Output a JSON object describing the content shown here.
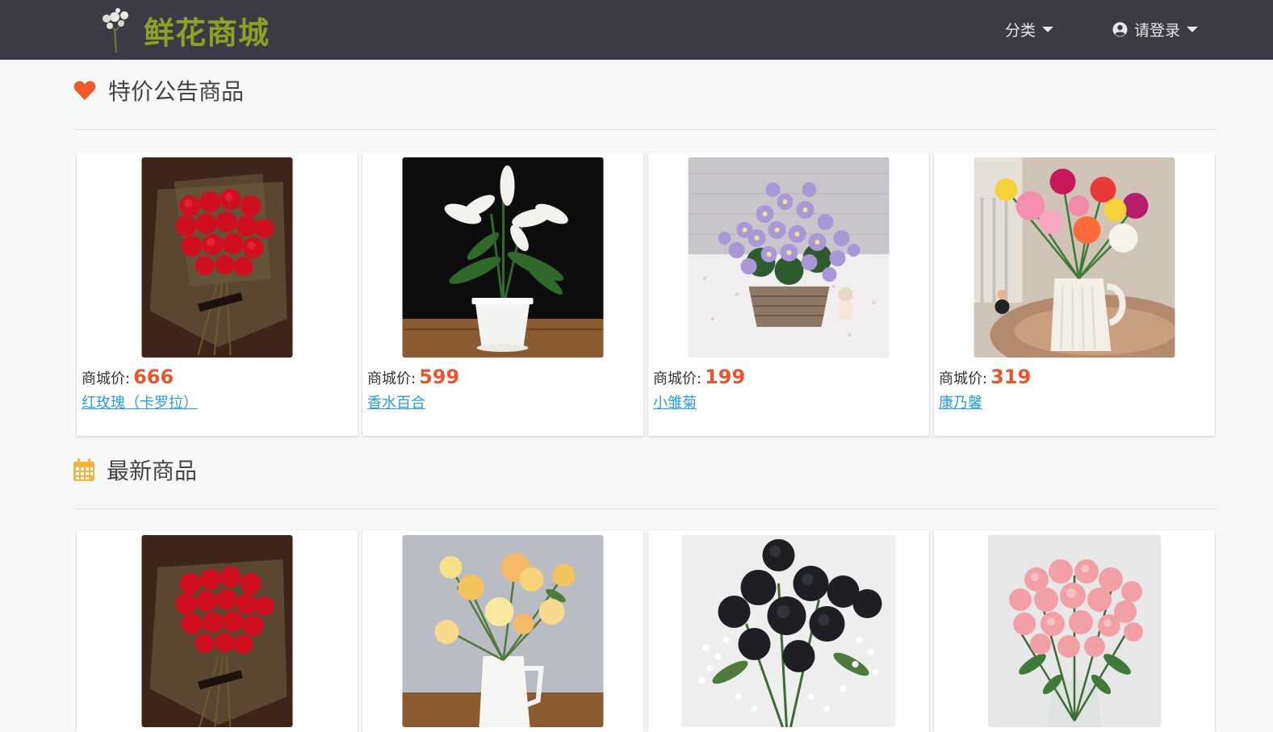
{
  "header": {
    "brand": "鲜花商城",
    "category_label": "分类",
    "login_label": "请登录"
  },
  "special_section": {
    "title": "特价公告商品",
    "price_label": "商城价:",
    "products": [
      {
        "name": "红玫瑰（卡罗拉）",
        "price": "666",
        "image": "red-rose-bouquet"
      },
      {
        "name": "香水百合",
        "price": "599",
        "image": "white-lily-pot"
      },
      {
        "name": "小雏菊",
        "price": "199",
        "image": "daisy-basket"
      },
      {
        "name": "康乃馨",
        "price": "319",
        "image": "carnation-vase"
      }
    ]
  },
  "new_section": {
    "title": "最新商品",
    "products": [
      {
        "image": "red-rose-bouquet"
      },
      {
        "image": "yellow-eustoma-vase"
      },
      {
        "image": "black-rose-bouquet"
      },
      {
        "image": "pink-rose-vase"
      }
    ]
  },
  "colors": {
    "navbar": "#3b3b45",
    "brand": "#8fa025",
    "price": "#e4572e",
    "link": "#2a9fd6",
    "heart_icon": "#f05a28",
    "calendar_icon": "#f5b33d"
  }
}
